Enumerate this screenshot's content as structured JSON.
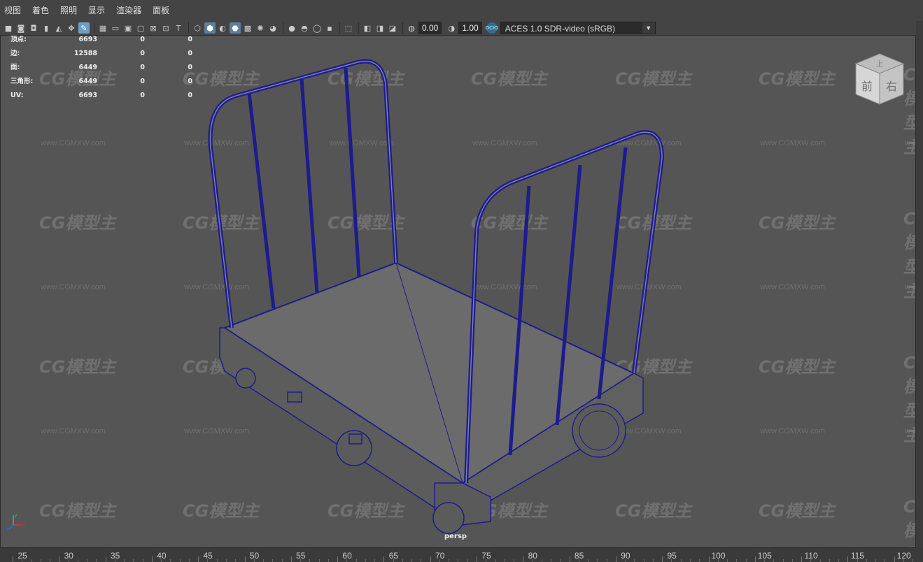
{
  "menu": {
    "items": [
      "视图",
      "着色",
      "照明",
      "显示",
      "渲染器",
      "面板"
    ]
  },
  "toolbar": {
    "exposure_value": "0.00",
    "gamma_value": "1.00",
    "color_space_badge": "OCIO",
    "color_space": "ACES 1.0 SDR-video (sRGB)"
  },
  "hud": {
    "rows": [
      {
        "label": "顶点:",
        "v1": "6693",
        "v2": "0",
        "v3": "0"
      },
      {
        "label": "边:",
        "v1": "12588",
        "v2": "0",
        "v3": "0"
      },
      {
        "label": "面:",
        "v1": "6449",
        "v2": "0",
        "v3": "0"
      },
      {
        "label": "三角形:",
        "v1": "6449",
        "v2": "0",
        "v3": "0"
      },
      {
        "label": "UV:",
        "v1": "6693",
        "v2": "0",
        "v3": "0"
      }
    ]
  },
  "viewport": {
    "camera": "persp"
  },
  "viewcube": {
    "top": "上",
    "front": "前",
    "right": "右"
  },
  "axis": {
    "x": "x",
    "y": "y",
    "z": "z"
  },
  "watermark": {
    "logo": "CG模型主",
    "url": "www.CGMXW.com"
  },
  "timeline": {
    "ticks": [
      "25",
      "30",
      "35",
      "40",
      "45",
      "50",
      "55",
      "60",
      "65",
      "70",
      "75",
      "80",
      "85",
      "90",
      "95",
      "100",
      "105",
      "110",
      "115",
      "120"
    ]
  },
  "colors": {
    "wireframe": "#1c1c8c",
    "viewport_bg": "#555555",
    "active_icon": "#5a7fa0"
  }
}
